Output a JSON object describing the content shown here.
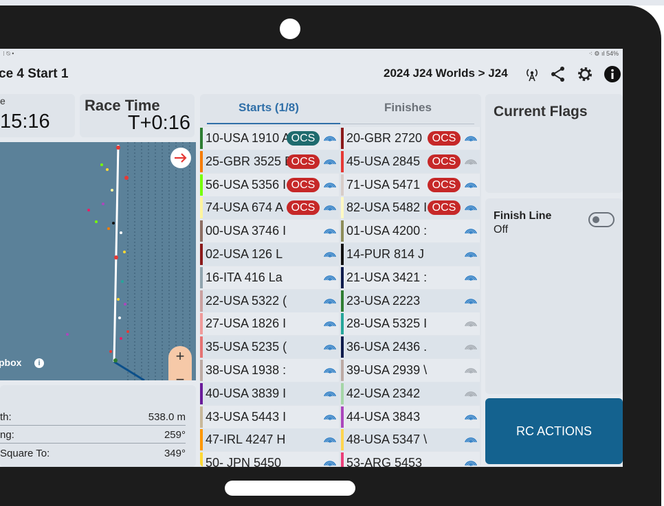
{
  "status": {
    "left": "⁝ ⍉ •",
    "right": "⁖ ⚙ ıl 54%"
  },
  "header": {
    "title": "ce 4 Start 1",
    "breadcrumb": "2024 J24 Worlds > J24"
  },
  "clock_left": {
    "value": ":15:16",
    "prefix": "e"
  },
  "race_time": {
    "label": "Race Time",
    "value": "T+0:16"
  },
  "map": {
    "attribution": "pbox"
  },
  "course_info": [
    {
      "key": "th:",
      "value": "538.0 m"
    },
    {
      "key": "ng:",
      "value": "259°"
    },
    {
      "key": "Square To:",
      "value": "349°"
    }
  ],
  "tabs": {
    "starts": "Starts (1/8)",
    "finishes": "Finishes"
  },
  "colors": {
    "ocs_teal": "#1f6b6e",
    "ocs_red": "#c62828",
    "accent": "#14628f",
    "signal_active": "#2f7fc6",
    "signal_inactive": "#a8aeb5"
  },
  "boats_left": [
    {
      "label": "10-USA 1910 A",
      "bar": "#2e7d32",
      "ocs": "OCS",
      "ocs_color": "#1f6b6e",
      "signal": true
    },
    {
      "label": "25-GBR 3525 E",
      "bar": "#f57c00",
      "ocs": "OCS",
      "ocs_color": "#c62828",
      "signal": true
    },
    {
      "label": "56-USA 5356 I",
      "bar": "#76ff03",
      "ocs": "OCS",
      "ocs_color": "#c62828",
      "signal": true
    },
    {
      "label": "74-USA 674 A",
      "bar": "#fff59d",
      "ocs": "OCS",
      "ocs_color": "#c62828",
      "signal": true
    },
    {
      "label": "00-USA 3746 I",
      "bar": "#8d6e63",
      "ocs": "",
      "ocs_color": "",
      "signal": true
    },
    {
      "label": "02-USA 126 L",
      "bar": "#8b1a1a",
      "ocs": "",
      "ocs_color": "",
      "signal": true
    },
    {
      "label": "16-ITA 416 La",
      "bar": "#90a4ae",
      "ocs": "",
      "ocs_color": "",
      "signal": true
    },
    {
      "label": "22-USA 5322 (",
      "bar": "#c9a0a0",
      "ocs": "",
      "ocs_color": "",
      "signal": true
    },
    {
      "label": "27-USA 1826 I",
      "bar": "#ef9a9a",
      "ocs": "",
      "ocs_color": "",
      "signal": true
    },
    {
      "label": "35-USA 5235 (",
      "bar": "#e57373",
      "ocs": "",
      "ocs_color": "",
      "signal": true
    },
    {
      "label": "38-USA 1938 :",
      "bar": "#bcaaa4",
      "ocs": "",
      "ocs_color": "",
      "signal": true
    },
    {
      "label": "40-USA 3839 I",
      "bar": "#6a1b9a",
      "ocs": "",
      "ocs_color": "",
      "signal": true
    },
    {
      "label": "43-USA 5443 I",
      "bar": "#c8b89a",
      "ocs": "",
      "ocs_color": "",
      "signal": true
    },
    {
      "label": "47-IRL 4247 H",
      "bar": "#ff9800",
      "ocs": "",
      "ocs_color": "",
      "signal": true
    },
    {
      "label": "50- JPN 5450",
      "bar": "#fdd835",
      "ocs": "",
      "ocs_color": "",
      "signal": true
    }
  ],
  "boats_right": [
    {
      "label": "20-GBR 2720 ",
      "bar": "#8b1a1a",
      "ocs": "OCS",
      "ocs_color": "#c62828",
      "signal": true
    },
    {
      "label": "45-USA 2845 ",
      "bar": "#e53935",
      "ocs": "OCS",
      "ocs_color": "#c62828",
      "signal": false
    },
    {
      "label": "71-USA 5471 ",
      "bar": "#d7ccc8",
      "ocs": "OCS",
      "ocs_color": "#c62828",
      "signal": true
    },
    {
      "label": "82-USA 5482 I",
      "bar": "#fff9c4",
      "ocs": "OCS",
      "ocs_color": "#c62828",
      "signal": true
    },
    {
      "label": "01-USA 4200 :",
      "bar": "#8d8d5a",
      "ocs": "",
      "ocs_color": "",
      "signal": true
    },
    {
      "label": "14-PUR 814 J",
      "bar": "#111111",
      "ocs": "",
      "ocs_color": "",
      "signal": true
    },
    {
      "label": "21-USA 3421 :",
      "bar": "#0d1b4c",
      "ocs": "",
      "ocs_color": "",
      "signal": true
    },
    {
      "label": "23-USA 2223 ",
      "bar": "#2e7d32",
      "ocs": "",
      "ocs_color": "",
      "signal": true
    },
    {
      "label": "28-USA 5325 I",
      "bar": "#26a69a",
      "ocs": "",
      "ocs_color": "",
      "signal": false
    },
    {
      "label": "36-USA 2436 .",
      "bar": "#0d1b4c",
      "ocs": "",
      "ocs_color": "",
      "signal": false
    },
    {
      "label": "39-USA 2939 \\",
      "bar": "#bcaaa4",
      "ocs": "",
      "ocs_color": "",
      "signal": false
    },
    {
      "label": "42-USA 2342 ",
      "bar": "#a5d6a7",
      "ocs": "",
      "ocs_color": "",
      "signal": false
    },
    {
      "label": "44-USA 3843 ",
      "bar": "#ab47bc",
      "ocs": "",
      "ocs_color": "",
      "signal": true
    },
    {
      "label": "48-USA 5347 \\",
      "bar": "#ffd54f",
      "ocs": "",
      "ocs_color": "",
      "signal": true
    },
    {
      "label": "53-ARG 5453",
      "bar": "#ec407a",
      "ocs": "",
      "ocs_color": "",
      "signal": true
    }
  ],
  "flags": {
    "title": "Current Flags"
  },
  "finish_line": {
    "title": "Finish Line",
    "state": "Off"
  },
  "rc_actions": {
    "label": "RC ACTIONS"
  }
}
